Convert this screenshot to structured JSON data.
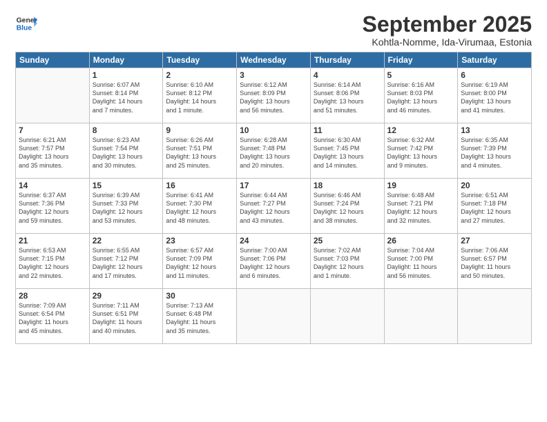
{
  "logo": {
    "line1": "General",
    "line2": "Blue"
  },
  "title": "September 2025",
  "subtitle": "Kohtla-Nomme, Ida-Virumaa, Estonia",
  "weekdays": [
    "Sunday",
    "Monday",
    "Tuesday",
    "Wednesday",
    "Thursday",
    "Friday",
    "Saturday"
  ],
  "weeks": [
    [
      {
        "day": "",
        "info": ""
      },
      {
        "day": "1",
        "info": "Sunrise: 6:07 AM\nSunset: 8:14 PM\nDaylight: 14 hours\nand 7 minutes."
      },
      {
        "day": "2",
        "info": "Sunrise: 6:10 AM\nSunset: 8:12 PM\nDaylight: 14 hours\nand 1 minute."
      },
      {
        "day": "3",
        "info": "Sunrise: 6:12 AM\nSunset: 8:09 PM\nDaylight: 13 hours\nand 56 minutes."
      },
      {
        "day": "4",
        "info": "Sunrise: 6:14 AM\nSunset: 8:06 PM\nDaylight: 13 hours\nand 51 minutes."
      },
      {
        "day": "5",
        "info": "Sunrise: 6:16 AM\nSunset: 8:03 PM\nDaylight: 13 hours\nand 46 minutes."
      },
      {
        "day": "6",
        "info": "Sunrise: 6:19 AM\nSunset: 8:00 PM\nDaylight: 13 hours\nand 41 minutes."
      }
    ],
    [
      {
        "day": "7",
        "info": "Sunrise: 6:21 AM\nSunset: 7:57 PM\nDaylight: 13 hours\nand 35 minutes."
      },
      {
        "day": "8",
        "info": "Sunrise: 6:23 AM\nSunset: 7:54 PM\nDaylight: 13 hours\nand 30 minutes."
      },
      {
        "day": "9",
        "info": "Sunrise: 6:26 AM\nSunset: 7:51 PM\nDaylight: 13 hours\nand 25 minutes."
      },
      {
        "day": "10",
        "info": "Sunrise: 6:28 AM\nSunset: 7:48 PM\nDaylight: 13 hours\nand 20 minutes."
      },
      {
        "day": "11",
        "info": "Sunrise: 6:30 AM\nSunset: 7:45 PM\nDaylight: 13 hours\nand 14 minutes."
      },
      {
        "day": "12",
        "info": "Sunrise: 6:32 AM\nSunset: 7:42 PM\nDaylight: 13 hours\nand 9 minutes."
      },
      {
        "day": "13",
        "info": "Sunrise: 6:35 AM\nSunset: 7:39 PM\nDaylight: 13 hours\nand 4 minutes."
      }
    ],
    [
      {
        "day": "14",
        "info": "Sunrise: 6:37 AM\nSunset: 7:36 PM\nDaylight: 12 hours\nand 59 minutes."
      },
      {
        "day": "15",
        "info": "Sunrise: 6:39 AM\nSunset: 7:33 PM\nDaylight: 12 hours\nand 53 minutes."
      },
      {
        "day": "16",
        "info": "Sunrise: 6:41 AM\nSunset: 7:30 PM\nDaylight: 12 hours\nand 48 minutes."
      },
      {
        "day": "17",
        "info": "Sunrise: 6:44 AM\nSunset: 7:27 PM\nDaylight: 12 hours\nand 43 minutes."
      },
      {
        "day": "18",
        "info": "Sunrise: 6:46 AM\nSunset: 7:24 PM\nDaylight: 12 hours\nand 38 minutes."
      },
      {
        "day": "19",
        "info": "Sunrise: 6:48 AM\nSunset: 7:21 PM\nDaylight: 12 hours\nand 32 minutes."
      },
      {
        "day": "20",
        "info": "Sunrise: 6:51 AM\nSunset: 7:18 PM\nDaylight: 12 hours\nand 27 minutes."
      }
    ],
    [
      {
        "day": "21",
        "info": "Sunrise: 6:53 AM\nSunset: 7:15 PM\nDaylight: 12 hours\nand 22 minutes."
      },
      {
        "day": "22",
        "info": "Sunrise: 6:55 AM\nSunset: 7:12 PM\nDaylight: 12 hours\nand 17 minutes."
      },
      {
        "day": "23",
        "info": "Sunrise: 6:57 AM\nSunset: 7:09 PM\nDaylight: 12 hours\nand 11 minutes."
      },
      {
        "day": "24",
        "info": "Sunrise: 7:00 AM\nSunset: 7:06 PM\nDaylight: 12 hours\nand 6 minutes."
      },
      {
        "day": "25",
        "info": "Sunrise: 7:02 AM\nSunset: 7:03 PM\nDaylight: 12 hours\nand 1 minute."
      },
      {
        "day": "26",
        "info": "Sunrise: 7:04 AM\nSunset: 7:00 PM\nDaylight: 11 hours\nand 56 minutes."
      },
      {
        "day": "27",
        "info": "Sunrise: 7:06 AM\nSunset: 6:57 PM\nDaylight: 11 hours\nand 50 minutes."
      }
    ],
    [
      {
        "day": "28",
        "info": "Sunrise: 7:09 AM\nSunset: 6:54 PM\nDaylight: 11 hours\nand 45 minutes."
      },
      {
        "day": "29",
        "info": "Sunrise: 7:11 AM\nSunset: 6:51 PM\nDaylight: 11 hours\nand 40 minutes."
      },
      {
        "day": "30",
        "info": "Sunrise: 7:13 AM\nSunset: 6:48 PM\nDaylight: 11 hours\nand 35 minutes."
      },
      {
        "day": "",
        "info": ""
      },
      {
        "day": "",
        "info": ""
      },
      {
        "day": "",
        "info": ""
      },
      {
        "day": "",
        "info": ""
      }
    ]
  ]
}
